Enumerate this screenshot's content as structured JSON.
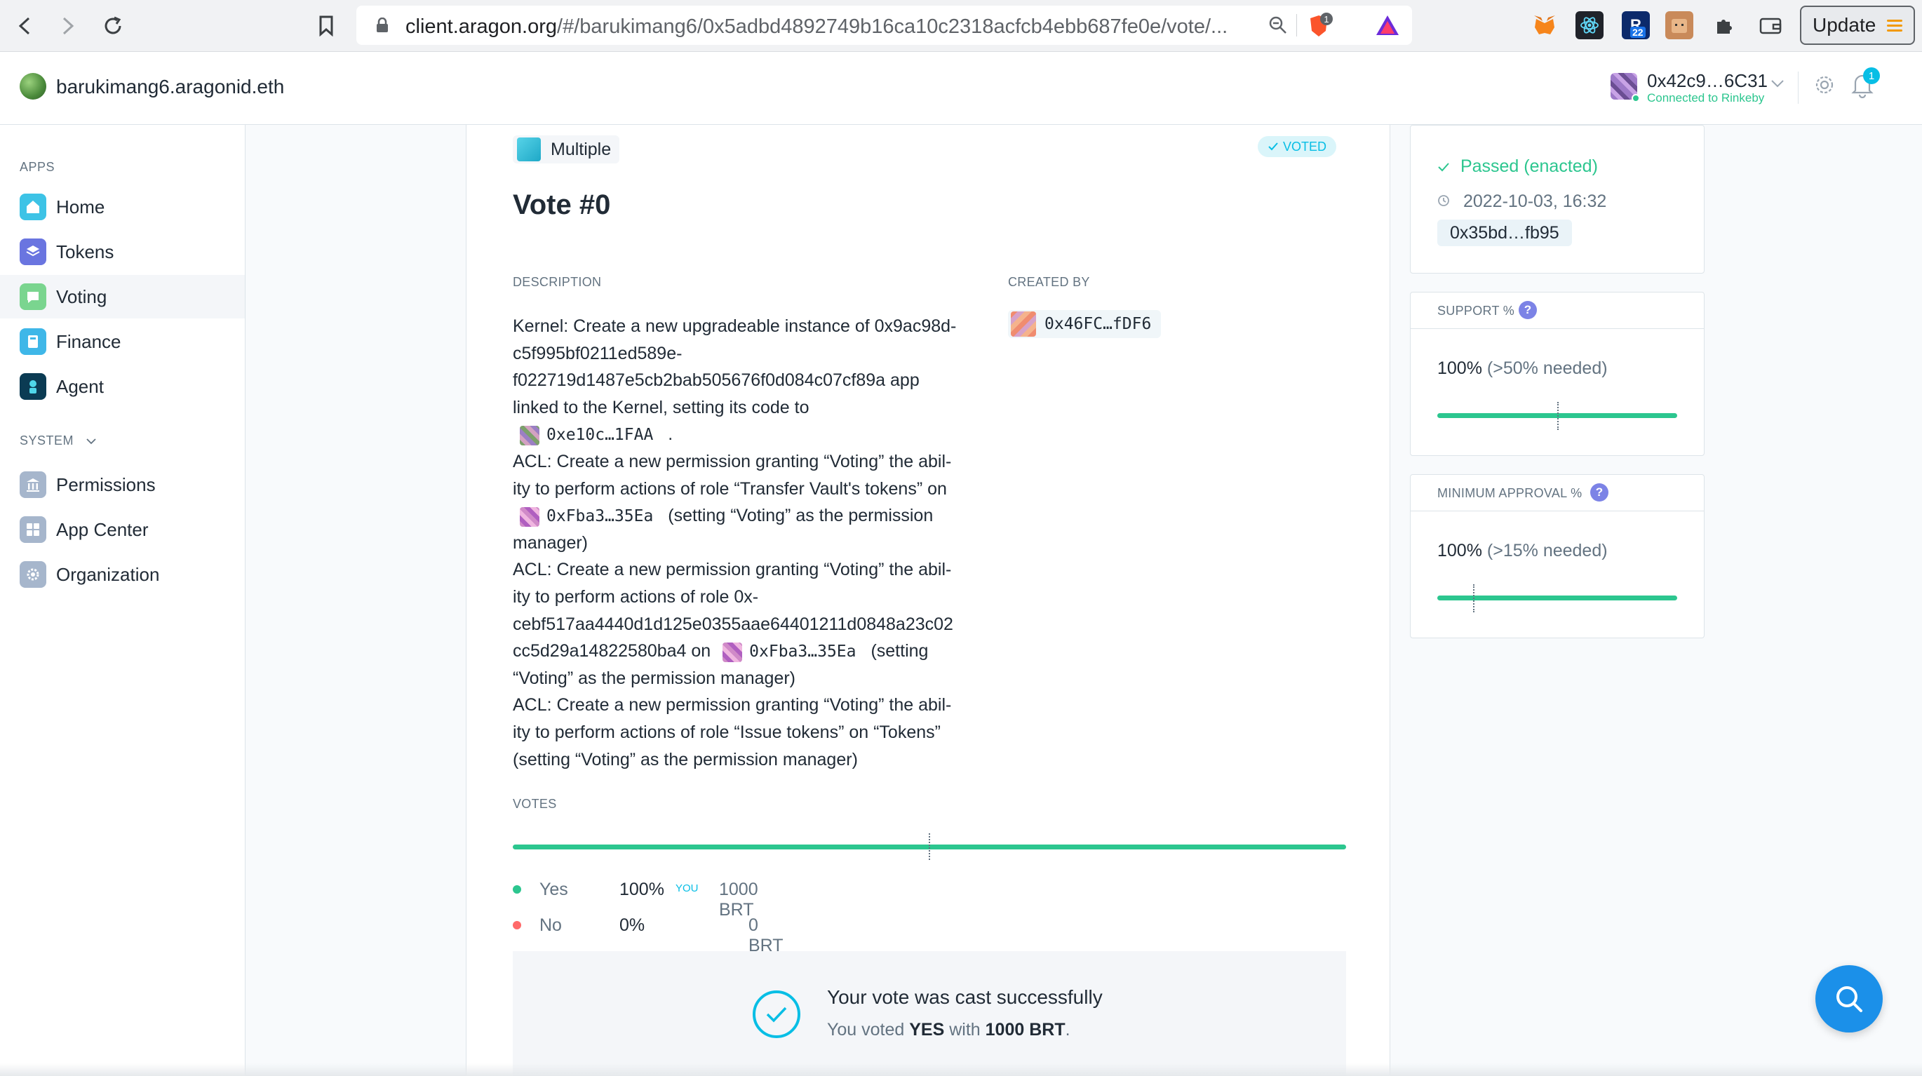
{
  "browser": {
    "url_host": "client.aragon.org",
    "url_path": "/#/barukimang6/0x5adbd4892749b16ca10c2318acfcb4ebb687fe0e/vote/...",
    "update_label": "Update",
    "brave_badge": "1",
    "ext_badge": "22"
  },
  "header": {
    "org_name": "barukimang6.aragonid.eth",
    "account_address": "0x42c9…6C31",
    "account_network": "Connected to Rinkeby",
    "notification_count": "1"
  },
  "sidebar": {
    "apps_heading": "APPS",
    "system_heading": "SYSTEM",
    "apps": [
      {
        "label": "Home",
        "icon": "home-icon",
        "color": "#3dc3e6"
      },
      {
        "label": "Tokens",
        "icon": "tokens-icon",
        "color": "#6a75e0"
      },
      {
        "label": "Voting",
        "icon": "voting-icon",
        "color": "#7ad58f"
      },
      {
        "label": "Finance",
        "icon": "finance-icon",
        "color": "#3fb7e8"
      },
      {
        "label": "Agent",
        "icon": "agent-icon",
        "color": "#0b3b53"
      }
    ],
    "system": [
      {
        "label": "Permissions",
        "icon": "permissions-icon",
        "color": "#a6b6cc"
      },
      {
        "label": "App Center",
        "icon": "app-center-icon",
        "color": "#a6b6cc"
      },
      {
        "label": "Organization",
        "icon": "organization-icon",
        "color": "#a6b6cc"
      }
    ]
  },
  "vote": {
    "app_badge": "Multiple",
    "voted_badge": "VOTED",
    "title": "Vote #0",
    "description_label": "DESCRIPTION",
    "created_by_label": "CREATED BY",
    "creator": "0x46FC…fDF6",
    "description": {
      "l1": "Kernel: Create a new upgradeable instance of 0x9ac98d-",
      "l2": "c5f995bf0211ed589e-",
      "l3": "f022719d1487e5cb2bab505676f0d084c07cf89a app",
      "l4": "linked to the Kernel, setting its code to",
      "l5_id": "0xe10c…1FAA",
      "l5_after": ".",
      "l6": "ACL: Create a new permission granting “Voting” the abil-",
      "l7": "ity to perform actions of role “Transfer Vault's tokens” on",
      "l8_id": "0xFba3…35Ea",
      "l8_after": "(setting “Voting” as the permission",
      "l9": "manager)",
      "l10": "ACL: Create a new permission granting “Voting” the abil-",
      "l11": "ity to perform actions of role 0x-",
      "l12": "cebf517aa4440d1d125e0355aae64401211d0848a23c02",
      "l13_before": "cc5d29a14822580ba4 on",
      "l13_id": "0xFba3…35Ea",
      "l13_after": "(setting",
      "l14": "“Voting” as the permission manager)",
      "l15": "ACL: Create a new permission granting “Voting” the abil-",
      "l16": "ity to perform actions of role “Issue tokens” on “Tokens”",
      "l17": "(setting “Voting” as the permission manager)"
    },
    "votes_label": "VOTES",
    "yes_label": "Yes",
    "yes_pct": "100%",
    "yes_you": "YOU",
    "yes_amount": "1000 BRT",
    "no_label": "No",
    "no_pct": "0%",
    "no_amount": "0 BRT",
    "yes_fraction": 1.0,
    "success_title": "Your vote was cast successfully",
    "success_prefix": "You voted",
    "success_choice": "YES",
    "success_with": "with",
    "success_amount": "1000 BRT",
    "success_end": "."
  },
  "status": {
    "state": "Passed (enacted)",
    "datetime": "2022-10-03, 16:32",
    "tx": "0x35bd…fb95"
  },
  "support": {
    "label": "SUPPORT %",
    "value": "100%",
    "needed": "(>50% needed)",
    "fraction": 1.0
  },
  "approval": {
    "label": "MINIMUM APPROVAL %",
    "value": "100%",
    "needed": "(>15% needed)",
    "fraction": 1.0
  },
  "colors": {
    "accent": "#08bee5",
    "yes": "#2cc68f",
    "no": "#ff6969"
  }
}
